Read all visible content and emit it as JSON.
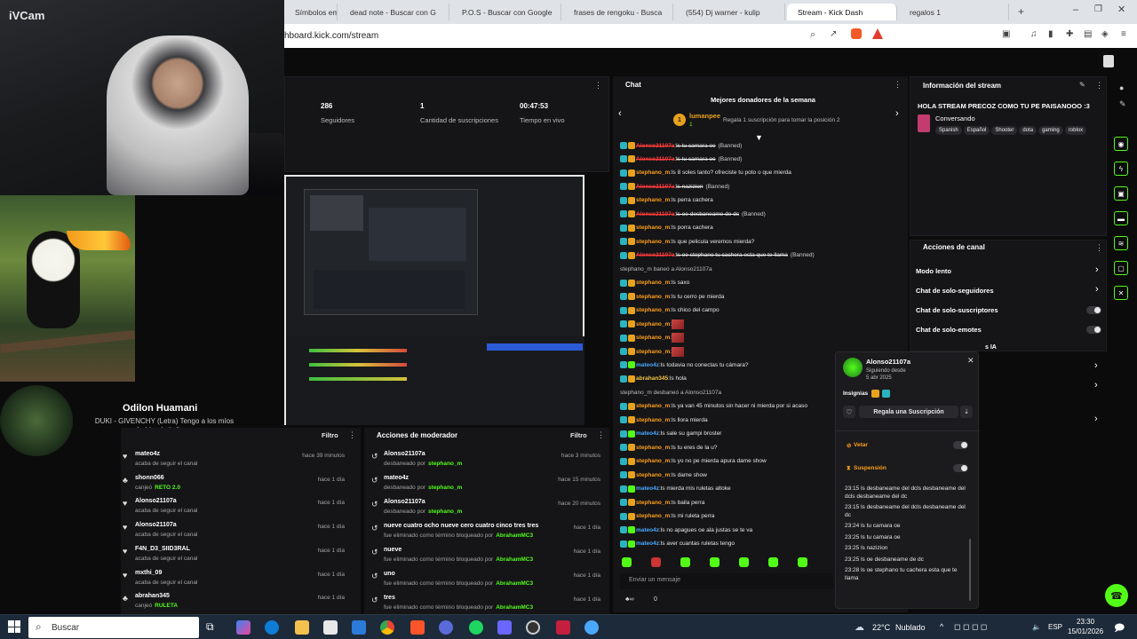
{
  "webcam": {
    "label": "iVCam"
  },
  "browser": {
    "tabs": [
      "Símbolos em",
      "dead note - Buscar con G",
      "P.O.S - Buscar con Google",
      "frases de rengoku - Busca",
      "(554) Dj warner - kulip",
      "Stream - Kick Dash",
      "regalos 1"
    ],
    "url": "hboard.kick.com/stream"
  },
  "stats": [
    {
      "value": "286",
      "label": "Seguidores"
    },
    {
      "value": "1",
      "label": "Cantidad de suscripciones"
    },
    {
      "value": "00:47:53",
      "label": "Tiempo en vivo"
    }
  ],
  "overlay": {
    "name": "Odilon Huamani",
    "song": "DUKI - GIVENCHY (Letra) Tengo a los míos hablando italiano"
  },
  "events": {
    "filter": "Filtro",
    "items": [
      {
        "icon": "heart-icon",
        "name": "mateo4z",
        "sub": "acaba de seguir el canal",
        "extra": "",
        "time": "hace 39 minutos"
      },
      {
        "icon": "gift-icon",
        "name": "shonn066",
        "sub": "canjeó",
        "extra": "RETO 2.0",
        "time": "hace 1 día"
      },
      {
        "icon": "heart-icon",
        "name": "Alonso21107a",
        "sub": "acaba de seguir el canal",
        "extra": "",
        "time": "hace 1 día"
      },
      {
        "icon": "heart-icon",
        "name": "Alonso21107a",
        "sub": "acaba de seguir el canal",
        "extra": "",
        "time": "hace 1 día"
      },
      {
        "icon": "heart-icon",
        "name": "F4N_D3_SIID3RAL",
        "sub": "acaba de seguir el canal",
        "extra": "",
        "time": "hace 1 día"
      },
      {
        "icon": "heart-icon",
        "name": "mxthi_09",
        "sub": "acaba de seguir el canal",
        "extra": "",
        "time": "hace 1 día"
      },
      {
        "icon": "gift-icon",
        "name": "abrahan345",
        "sub": "canjeó",
        "extra": "RULETA",
        "time": "hace 1 día"
      }
    ]
  },
  "mod_actions": {
    "title": "Acciones de moderador",
    "filter": "Filtro",
    "items": [
      {
        "name": "Alonso21107a",
        "sub": "desbaneado por",
        "by": "stephano_m",
        "time": "hace 3 minutos"
      },
      {
        "name": "mateo4z",
        "sub": "desbaneado por",
        "by": "stephano_m",
        "time": "hace 15 minutos"
      },
      {
        "name": "Alonso21107a",
        "sub": "desbaneado por",
        "by": "stephano_m",
        "time": "hace 20 minutos"
      },
      {
        "name": "nueve cuatro ocho nueve cero cuatro cinco tres tres",
        "sub": "fue eliminado como término bloqueado por",
        "by": "AbrahamMC3",
        "time": "hace 1 día"
      },
      {
        "name": "nueve",
        "sub": "fue eliminado como término bloqueado por",
        "by": "AbrahamMC3",
        "time": "hace 1 día"
      },
      {
        "name": "uno",
        "sub": "fue eliminado como término bloqueado por",
        "by": "AbrahamMC3",
        "time": "hace 1 día"
      },
      {
        "name": "tres",
        "sub": "fue eliminado como término bloqueado por",
        "by": "AbrahamMC3",
        "time": "hace 1 día"
      }
    ]
  },
  "chat": {
    "title": "Chat",
    "top_donors_title": "Mejores donadores de la semana",
    "donor_name": "lumanpee",
    "donor_count": "1",
    "donor_hint": "Regala 1 suscripción para tomar la posición 2",
    "input_placeholder": "Enviar un mensaje",
    "footer_count": "0",
    "messages": [
      {
        "user": "Alonso21107a",
        "color": "r",
        "text": "ls tu camara oe",
        "banned": "(Banned)"
      },
      {
        "user": "Alonso21107a",
        "color": "r",
        "text": "ls tu camara oe",
        "banned": "(Banned)"
      },
      {
        "user": "stephano_m",
        "color": "o",
        "text": "ls 8 soles tanto? ofreciste tu poto o que mierda",
        "banned": ""
      },
      {
        "user": "Alonso21107a",
        "color": "r",
        "text": "ls nazizion",
        "banned": "(Banned)"
      },
      {
        "user": "stephano_m",
        "color": "o",
        "text": "ls perra cachera",
        "banned": ""
      },
      {
        "user": "Alonso21107a",
        "color": "r",
        "text": "ls oe desbaneame de dc",
        "banned": "(Banned)"
      },
      {
        "user": "stephano_m",
        "color": "o",
        "text": "ls porra cachera",
        "banned": ""
      },
      {
        "user": "stephano_m",
        "color": "o",
        "text": "ls que pelicula veremos mierda?",
        "banned": ""
      },
      {
        "user": "Alonso21107a",
        "color": "r",
        "text": "ls oe stephano tu cachera esta que te llama",
        "banned": "(Banned)"
      },
      {
        "user": "",
        "color": "sys",
        "text": "stephano_m baneó a Alonso21107a",
        "banned": ""
      },
      {
        "user": "stephano_m",
        "color": "o",
        "text": "ls saxo",
        "banned": ""
      },
      {
        "user": "stephano_m",
        "color": "o",
        "text": "ls tu cerro pe mierda",
        "banned": ""
      },
      {
        "user": "stephano_m",
        "color": "o",
        "text": "ls chico del campo",
        "banned": ""
      },
      {
        "user": "stephano_m",
        "color": "o",
        "text": "",
        "banned": ""
      },
      {
        "user": "stephano_m",
        "color": "o",
        "text": "",
        "banned": ""
      },
      {
        "user": "stephano_m",
        "color": "o",
        "text": "",
        "banned": ""
      },
      {
        "user": "mateo4z",
        "color": "b",
        "text": "ls todavia no conectas tu cámara?",
        "banned": ""
      },
      {
        "user": "abrahan345",
        "color": "g",
        "text": "ls hola",
        "banned": ""
      },
      {
        "user": "",
        "color": "sys",
        "text": "stephano_m desbaneó a Alonso21107a",
        "banned": ""
      },
      {
        "user": "stephano_m",
        "color": "o",
        "text": "ls ya van 45 minutos sin hacer ni mierda por si acaso",
        "banned": ""
      },
      {
        "user": "stephano_m",
        "color": "o",
        "text": "ls llora mierda",
        "banned": ""
      },
      {
        "user": "mateo4z",
        "color": "b",
        "text": "ls sale su gampi broster",
        "banned": ""
      },
      {
        "user": "stephano_m",
        "color": "o",
        "text": "ls tu eres de la u?",
        "banned": ""
      },
      {
        "user": "stephano_m",
        "color": "o",
        "text": "ls yo no pe mierda apura dame show",
        "banned": ""
      },
      {
        "user": "stephano_m",
        "color": "o",
        "text": "ls dame show",
        "banned": ""
      },
      {
        "user": "mateo4z",
        "color": "b",
        "text": "ls mierda mis ruletas altoke",
        "banned": ""
      },
      {
        "user": "stephano_m",
        "color": "o",
        "text": "ls baila perra",
        "banned": ""
      },
      {
        "user": "stephano_m",
        "color": "o",
        "text": "ls mi ruleta perra",
        "banned": ""
      },
      {
        "user": "mateo4z",
        "color": "b",
        "text": "ls no apagues oe ala justas se te va",
        "banned": ""
      },
      {
        "user": "mateo4z",
        "color": "b",
        "text": "ls aver cuantas ruletas tengo",
        "banned": ""
      }
    ]
  },
  "stream_info": {
    "title": "Información del stream",
    "stream_title": "HOLA STREAM PRECOZ COMO TU PE PAISANOOO :3",
    "category": "Conversando",
    "tags": [
      "Spanish",
      "Español",
      "Shooter",
      "dota",
      "gaming",
      "roblox"
    ]
  },
  "channel_actions": {
    "title": "Acciones de canal",
    "items": [
      {
        "label": "Modo lento",
        "control": "chevron"
      },
      {
        "label": "Chat de solo-seguidores",
        "control": "chevron"
      },
      {
        "label": "Chat de solo-suscriptores",
        "control": "toggle"
      },
      {
        "label": "Chat de solo-emotes",
        "control": "toggle"
      }
    ],
    "partial_label": "s IA"
  },
  "user_card": {
    "name": "Alonso21107a",
    "following_label": "Siguiendo desde",
    "following_date": "5 abr 2025",
    "insignias_label": "Insignias",
    "gift_label": "Regala una Suscripción",
    "veto_label": "Vetar",
    "suspension_label": "Suspensión",
    "history": [
      "23:15 ls desbaneame del dcls desbaneame del dcls desbaneame del dc",
      "23:15 ls desbaneame del dcls desbaneame del dc",
      "23:24 ls tu camara oe",
      "23:25 ls tu camara oe",
      "23:25 ls nazizion",
      "23:25 ls oe desbaneame de dc",
      "23:28 ls oe stephano tu cachera esta que te llama"
    ]
  },
  "taskbar": {
    "search_placeholder": "Buscar",
    "weather": "22°C",
    "weather_desc": "Nublado",
    "lang": "ESP",
    "time": "23:30",
    "date": "15/01/2026"
  },
  "colors": {
    "accent": "#53fc18",
    "background": "#0b0b0c",
    "panel": "#151517"
  }
}
